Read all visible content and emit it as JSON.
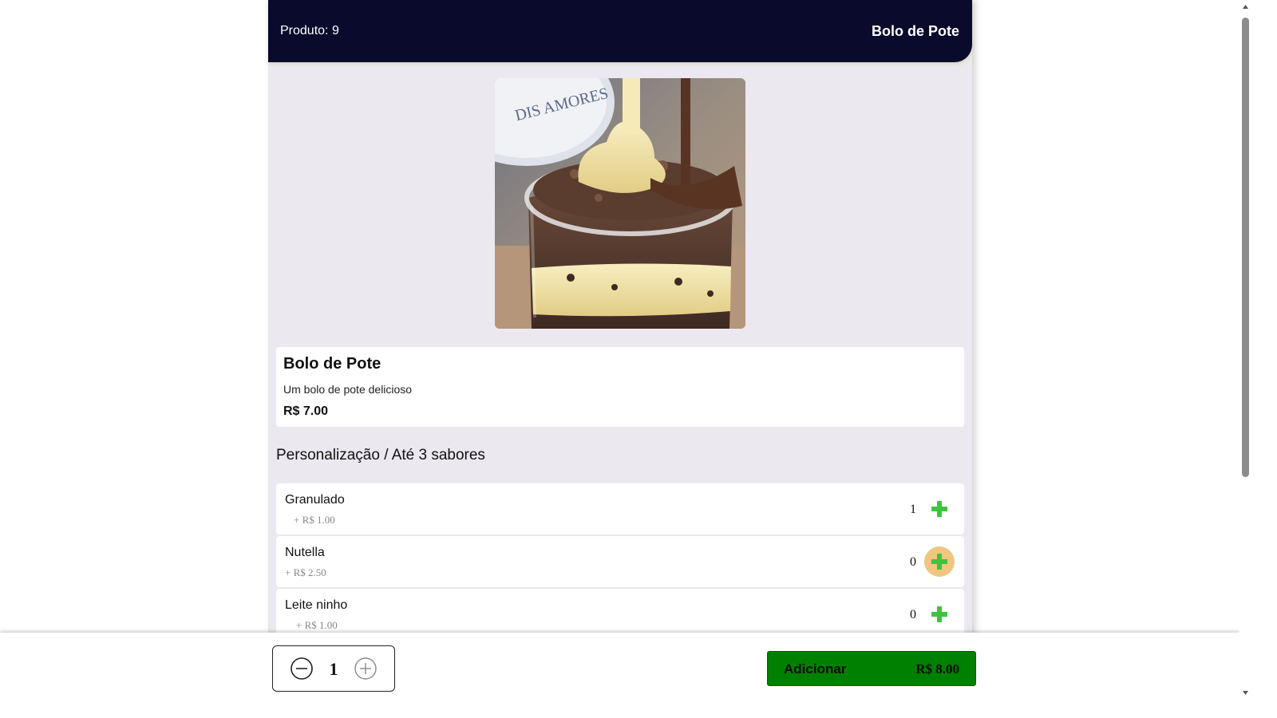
{
  "header": {
    "product_label": "Produto:",
    "product_number": "9",
    "title": "Bolo de Pote"
  },
  "product": {
    "image_alt": "Bolo de Pote",
    "name": "Bolo de Pote",
    "description": "Um bolo de pote delicioso",
    "price": "R$ 7.00"
  },
  "customization": {
    "title": "Personalização / Até 3 sabores",
    "options": [
      {
        "name": "Granulado",
        "price": "+ R$ 1.00",
        "count": "1"
      },
      {
        "name": "Nutella",
        "price": "+ R$ 2.50",
        "count": "0"
      },
      {
        "name": "Leite ninho",
        "price": "+ R$ 1.00",
        "count": "0"
      }
    ]
  },
  "footer": {
    "quantity": "1",
    "add_label": "Adicionar",
    "total": "R$ 8.00"
  },
  "colors": {
    "header_bg": "#0a0a2c",
    "card_bg": "#ebe8ef",
    "add_button_bg": "#008000",
    "plus_icon": "#3ec43e",
    "plus_hover_bg": "#f0c680"
  },
  "icons": {
    "option_add": "plus-icon",
    "qty_decrease": "minus-circle-icon",
    "qty_increase": "plus-circle-icon"
  }
}
